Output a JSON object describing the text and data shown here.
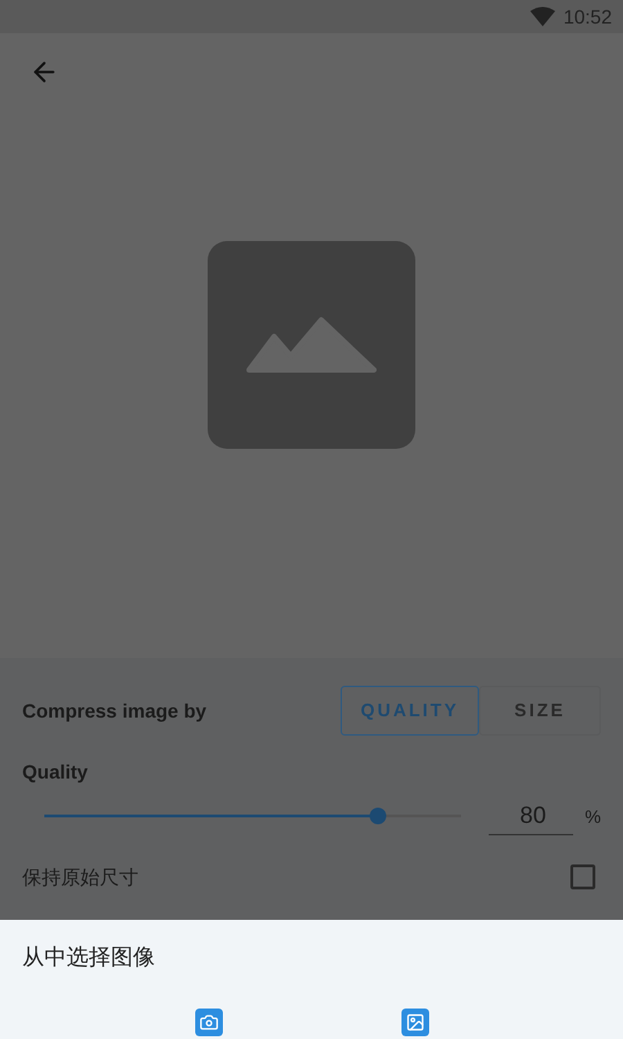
{
  "status_bar": {
    "time": "10:52"
  },
  "compress": {
    "label": "Compress image by",
    "tabs": [
      {
        "label": "QUALITY",
        "selected": true
      },
      {
        "label": "SIZE",
        "selected": false
      }
    ]
  },
  "quality": {
    "label": "Quality",
    "level": 0.8,
    "value": "80",
    "unit": "%"
  },
  "keep_size": {
    "label": "保持原始尺寸",
    "checked": false
  },
  "sheet": {
    "title": "从中选择图像",
    "options": [
      {
        "kind": "camera"
      },
      {
        "kind": "gallery"
      }
    ]
  }
}
